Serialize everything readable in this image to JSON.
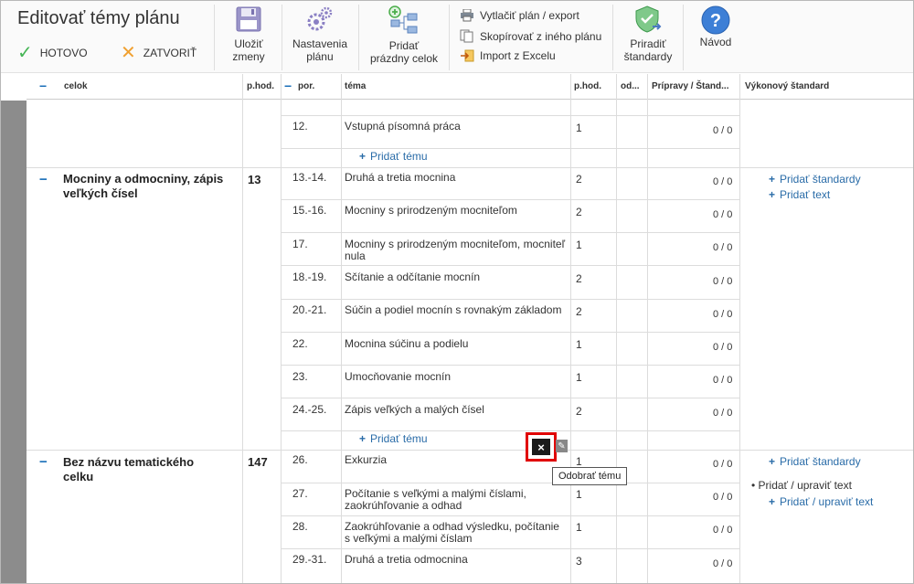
{
  "window": {
    "title": "Editovať témy plánu"
  },
  "toolbar": {
    "done_label": "HOTOVO",
    "close_label": "ZATVORIŤ",
    "save_label_1": "Uložiť",
    "save_label_2": "zmeny",
    "settings_label_1": "Nastavenia",
    "settings_label_2": "plánu",
    "add_empty_label_1": "Pridať",
    "add_empty_label_2": "prázdny celok",
    "print_label": "Vytlačiť plán / export",
    "copy_label": "Skopírovať z iného plánu",
    "import_label": "Import z Excelu",
    "assign_label_1": "Priradiť",
    "assign_label_2": "štandardy",
    "help_label": "Návod"
  },
  "columns": {
    "celok": "celok",
    "phod": "p.hod.",
    "por": "por.",
    "tema": "téma",
    "phod2": "p.hod.",
    "od": "od...",
    "pripravy": "Prípravy / Štand...",
    "vykonovy": "Výkonový štandard"
  },
  "rows_top": [
    {
      "por": "12.",
      "tema": "Vstupná písomná práca",
      "hod": "1",
      "ratio": "0 / 0"
    }
  ],
  "add_topic": "Pridať tému",
  "group1": {
    "minus": "−",
    "name_line1": "Mocniny a odmocniny, zápis",
    "name_line2": "veľkých čísel",
    "hod": "13",
    "add_standards": "Pridať štandardy",
    "add_text": "Pridať text",
    "rows": [
      {
        "por": "13.-14.",
        "tema1": "Druhá a tretia mocnina",
        "tema2": "",
        "hod": "2",
        "ratio": "0 / 0"
      },
      {
        "por": "15.-16.",
        "tema1": "Mocniny s prirodzeným mocniteľom",
        "tema2": "",
        "hod": "2",
        "ratio": "0 / 0"
      },
      {
        "por": "17.",
        "tema1": "Mocniny s prirodzeným mocniteľom, mocniteľ",
        "tema2": "nula",
        "hod": "1",
        "ratio": "0 / 0"
      },
      {
        "por": "18.-19.",
        "tema1": "Sčítanie a odčítanie mocnín",
        "tema2": "",
        "hod": "2",
        "ratio": "0 / 0"
      },
      {
        "por": "20.-21.",
        "tema1": "Súčin a podiel mocnín s rovnakým základom",
        "tema2": "",
        "hod": "2",
        "ratio": "0 / 0"
      },
      {
        "por": "22.",
        "tema1": "Mocnina súčinu a podielu",
        "tema2": "",
        "hod": "1",
        "ratio": "0 / 0"
      },
      {
        "por": "23.",
        "tema1": "Umocňovanie mocnín",
        "tema2": "",
        "hod": "1",
        "ratio": "0 / 0"
      },
      {
        "por": "24.-25.",
        "tema1": "Zápis veľkých a malých čísel",
        "tema2": "",
        "hod": "2",
        "ratio": "0 / 0"
      }
    ]
  },
  "group2": {
    "minus": "−",
    "name_line1": "Bez názvu tematického",
    "name_line2": "celku",
    "hod": "147",
    "add_standards": "Pridať štandardy",
    "bullet_text": "Pridať / upraviť text",
    "add_edit_text": "Pridať / upraviť text",
    "rows": [
      {
        "por": "26.",
        "tema1": "Exkurzia",
        "tema2": "",
        "hod": "1",
        "ratio": "0 / 0"
      },
      {
        "por": "27.",
        "tema1": "Počítanie s veľkými a malými číslami,",
        "tema2": "zaokrúhľovanie a odhad",
        "hod": "1",
        "ratio": "0 / 0"
      },
      {
        "por": "28.",
        "tema1": "Zaokrúhľovanie a odhad výsledku, počítanie",
        "tema2": "s veľkými a malými číslam",
        "hod": "1",
        "ratio": "0 / 0"
      },
      {
        "por": "29.-31.",
        "tema1": "Druhá a tretia odmocnina",
        "tema2": "",
        "hod": "3",
        "ratio": "0 / 0"
      }
    ]
  },
  "tooltip": {
    "remove_topic": "Odobrať tému"
  },
  "icons": {
    "remove": "×",
    "edit": "✎",
    "plus": "+",
    "minus": "−"
  }
}
